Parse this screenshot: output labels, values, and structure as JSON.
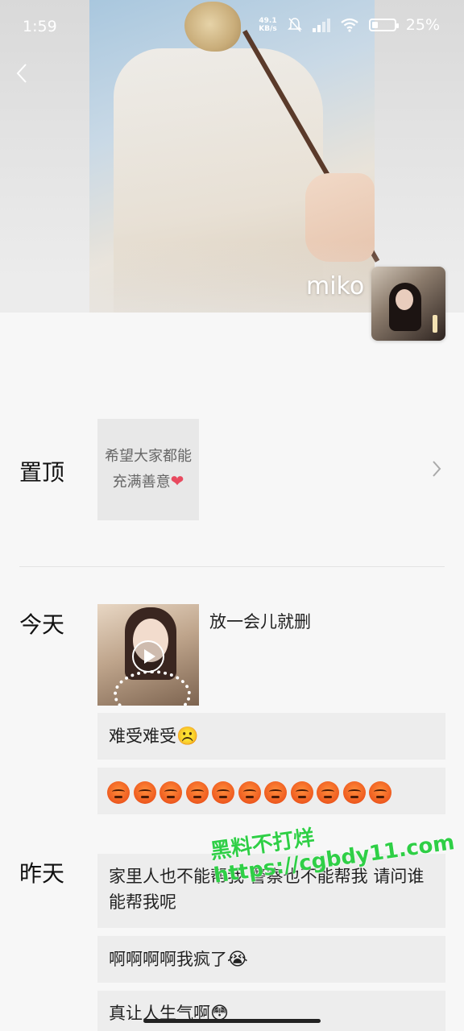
{
  "status_bar": {
    "time": "1:59",
    "net_speed": "49.1",
    "net_unit": "KB/s",
    "battery_percent": "25%",
    "battery_level": 0.25
  },
  "profile": {
    "name": "miko"
  },
  "pinned": {
    "label": "置顶",
    "card_text_line1": "希望大家都能",
    "card_text_line2": "充满善意",
    "heart": "❤"
  },
  "today": {
    "label": "今天",
    "video_caption": "放一会儿就删",
    "posts": [
      {
        "text": "难受难受",
        "emoji": "☹️"
      },
      {
        "angry_count": 11
      }
    ]
  },
  "yesterday": {
    "label": "昨天",
    "posts": [
      {
        "text": "家里人也不能帮我 警察也不能帮我 请问谁能帮我呢"
      },
      {
        "text": "啊啊啊啊我疯了",
        "emoji": "😭"
      },
      {
        "text": "真让人生气啊",
        "emoji": "😳"
      }
    ]
  },
  "watermark": {
    "line1": "黑料不打烊",
    "line2": "https://cgbdy11.com"
  },
  "colors": {
    "background": "#f7f7f7",
    "bubble": "#ededed",
    "watermark": "#2fcf46"
  }
}
